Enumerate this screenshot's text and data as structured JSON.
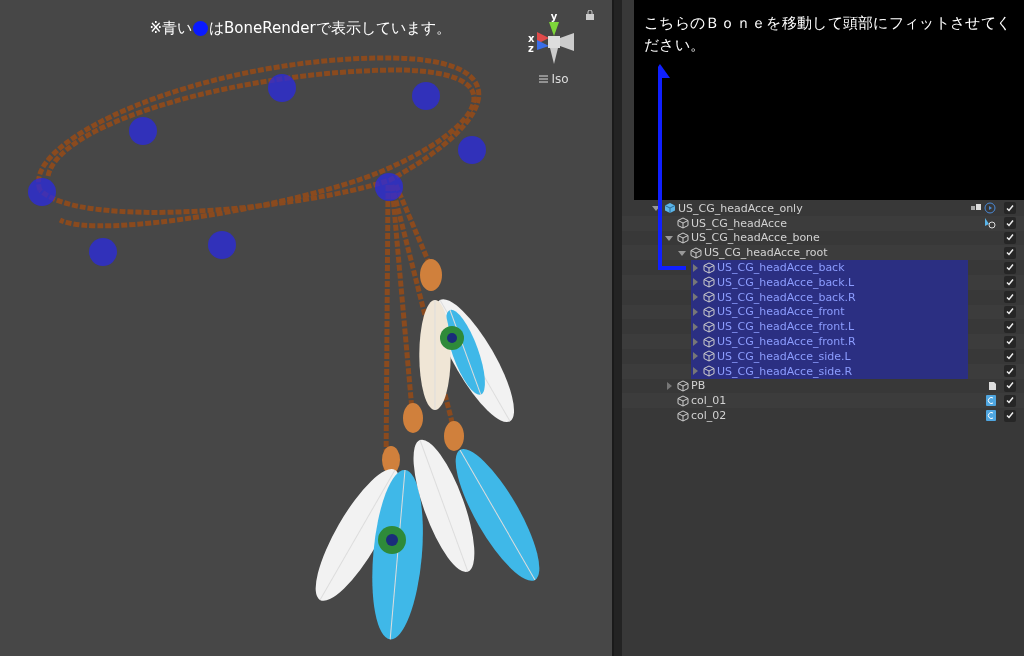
{
  "viewport": {
    "caption_before": "※青い",
    "caption_after": "はBoneRenderで表示しています。",
    "gizmo": {
      "axis_y": "y",
      "axis_x": "x",
      "axis_z": "z"
    },
    "projection": "Iso"
  },
  "note": {
    "text": "こちらのＢｏｎｅを移動して頭部にフィットさせてください。"
  },
  "hierarchy": {
    "items": [
      {
        "name": "US_CG_headAcce_only",
        "kind": "prefab",
        "expanded": true,
        "selected": false,
        "checked": true,
        "children": [
          {
            "name": "US_CG_headAcce",
            "kind": "renderer",
            "selected": false,
            "checked": true
          },
          {
            "name": "US_CG_headAcce_bone",
            "kind": "object",
            "expanded": true,
            "selected": false,
            "checked": true,
            "children": [
              {
                "name": "US_CG_headAcce_root",
                "kind": "object",
                "expanded": true,
                "selected": false,
                "checked": true,
                "children": [
                  {
                    "name": "US_CG_headAcce_back",
                    "kind": "object",
                    "expanded": false,
                    "selected": true,
                    "checked": true
                  },
                  {
                    "name": "US_CG_headAcce_back.L",
                    "kind": "object",
                    "expanded": false,
                    "selected": true,
                    "checked": true
                  },
                  {
                    "name": "US_CG_headAcce_back.R",
                    "kind": "object",
                    "expanded": false,
                    "selected": true,
                    "checked": true
                  },
                  {
                    "name": "US_CG_headAcce_front",
                    "kind": "object",
                    "expanded": false,
                    "selected": true,
                    "checked": true
                  },
                  {
                    "name": "US_CG_headAcce_front.L",
                    "kind": "object",
                    "expanded": false,
                    "selected": true,
                    "checked": true
                  },
                  {
                    "name": "US_CG_headAcce_front.R",
                    "kind": "object",
                    "expanded": false,
                    "selected": true,
                    "checked": true
                  },
                  {
                    "name": "US_CG_headAcce_side.L",
                    "kind": "object",
                    "expanded": false,
                    "selected": true,
                    "checked": true
                  },
                  {
                    "name": "US_CG_headAcce_side.R",
                    "kind": "object",
                    "expanded": false,
                    "selected": true,
                    "checked": true
                  }
                ]
              }
            ]
          },
          {
            "name": "PB",
            "kind": "note",
            "expanded": false,
            "selected": false,
            "checked": true
          },
          {
            "name": "col_01",
            "kind": "script",
            "selected": false,
            "checked": true
          },
          {
            "name": "col_02",
            "kind": "script",
            "selected": false,
            "checked": true
          }
        ]
      }
    ]
  }
}
